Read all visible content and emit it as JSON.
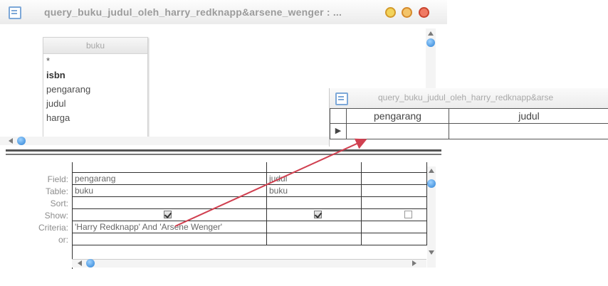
{
  "design_window": {
    "title": "query_buku_judul_oleh_harry_redknapp&arsene_wenger : ...",
    "table": {
      "name": "buku",
      "fields": [
        "*",
        "isbn",
        "pengarang",
        "judul",
        "harga"
      ]
    }
  },
  "grid": {
    "row_labels": [
      "Field:",
      "Table:",
      "Sort:",
      "Show:",
      "Criteria:",
      "or:"
    ],
    "columns": [
      {
        "field": "pengarang",
        "table": "buku",
        "sort": "",
        "show": true,
        "criteria": "'Harry Redknapp' And 'Arsene Wenger'",
        "or": ""
      },
      {
        "field": "judul",
        "table": "buku",
        "sort": "",
        "show": true,
        "criteria": "",
        "or": ""
      },
      {
        "field": "",
        "table": "",
        "sort": "",
        "show": false,
        "criteria": "",
        "or": ""
      }
    ]
  },
  "datasheet": {
    "title": "query_buku_judul_oleh_harry_redknapp&arse",
    "headers": [
      "pengarang",
      "judul"
    ],
    "record_selector": "▶"
  },
  "colors": {
    "annotation_arrow": "#d04050",
    "scroll_thumb": "#2a7fd4"
  }
}
